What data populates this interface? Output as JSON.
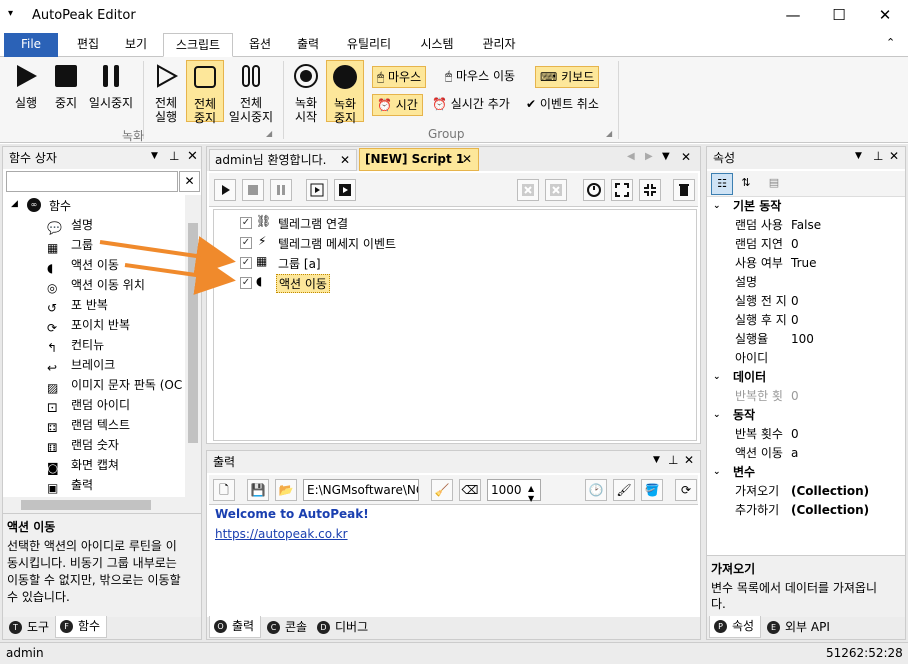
{
  "app": {
    "title": "AutoPeak Editor",
    "window_min": "—",
    "window_max": "☐",
    "window_close": "✕"
  },
  "menu_tabs": [
    "File",
    "편집",
    "보기",
    "스크립트",
    "옵션",
    "출력",
    "유틸리티",
    "시스템",
    "관리자"
  ],
  "ribbon": {
    "run": "실행",
    "stop": "중지",
    "pause": "일시중지",
    "all_run": [
      "전체",
      "실행"
    ],
    "all_stop": [
      "전체",
      "중지"
    ],
    "all_pause": [
      "전체",
      "일시중지"
    ],
    "rec_start": [
      "녹화",
      "시작"
    ],
    "rec_stop": [
      "녹화",
      "중지"
    ],
    "mouse": "마우스",
    "mouse_move": "마우스 이동",
    "keyboard": "키보드",
    "time": "시간",
    "realtime_add": "실시간 추가",
    "event_cancel": "이벤트 취소",
    "group_record": "녹화",
    "group_group": "Group"
  },
  "left_panel": {
    "title": "함수 상자",
    "root": "함수",
    "items": [
      "설명",
      "그룹",
      "액션 이동",
      "액션 이동 위치",
      "포 반복",
      "포이치 반복",
      "컨티뉴",
      "브레이크",
      "이미지 문자 판독 (OC",
      "랜덤 아이디",
      "랜덤 텍스트",
      "랜덤 숫자",
      "화면 캡쳐",
      "출력"
    ],
    "desc_title": "액션 이동",
    "desc_text": [
      "선택한 액션의 아이디로 루틴을 이",
      "동시킵니다. 비동기 그룹 내부로는",
      "이동할 수 없지만, 밖으로는 이동할",
      "수 있습니다."
    ],
    "tabs": [
      "도구",
      "함수"
    ]
  },
  "doc_tabs": [
    "admin님 환영합니다.",
    "[NEW] Script 1"
  ],
  "script": {
    "items": [
      "텔레그램 연결",
      "텔레그램 메세지 이벤트",
      "그룹 [a]",
      "액션 이동"
    ]
  },
  "output": {
    "title": "출력",
    "path": "E:\\NGMsoftware\\NG",
    "count": "1000",
    "line1": "Welcome to AutoPeak!",
    "line2": "https://autopeak.co.kr",
    "tabs": [
      "출력",
      "콘솔",
      "디버그"
    ]
  },
  "props": {
    "title": "속성",
    "rows": [
      {
        "cat": "기본 동작"
      },
      {
        "k": "랜덤 사용",
        "v": "False"
      },
      {
        "k": "랜덤 지연",
        "v": "0"
      },
      {
        "k": "사용 여부",
        "v": "True"
      },
      {
        "k": "설명",
        "v": ""
      },
      {
        "k": "실행 전 지",
        "v": "0"
      },
      {
        "k": "실행 후 지",
        "v": "0"
      },
      {
        "k": "실행율",
        "v": "100"
      },
      {
        "k": "아이디",
        "v": ""
      },
      {
        "cat": "데이터"
      },
      {
        "k": "반복한 횟",
        "v": "0",
        "dim": true
      },
      {
        "cat": "동작"
      },
      {
        "k": "반복 횟수",
        "v": "0"
      },
      {
        "k": "액션 이동",
        "v": "a"
      },
      {
        "cat": "변수"
      },
      {
        "k": "가져오기",
        "v": "(Collection)",
        "bold": true
      },
      {
        "k": "추가하기",
        "v": "(Collection)",
        "bold": true
      }
    ],
    "desc_title": "가져오기",
    "desc_text": [
      "변수 목록에서 데이터를 가져옵니",
      "다."
    ],
    "tabs": [
      "속성",
      "외부 API"
    ]
  },
  "status": {
    "user": "admin",
    "time": "51262:52:28"
  },
  "colors": {
    "accent": "#2b62b7",
    "highlight": "#fde79a",
    "arrow": "#f08a2c",
    "link": "#1a3fb0"
  }
}
